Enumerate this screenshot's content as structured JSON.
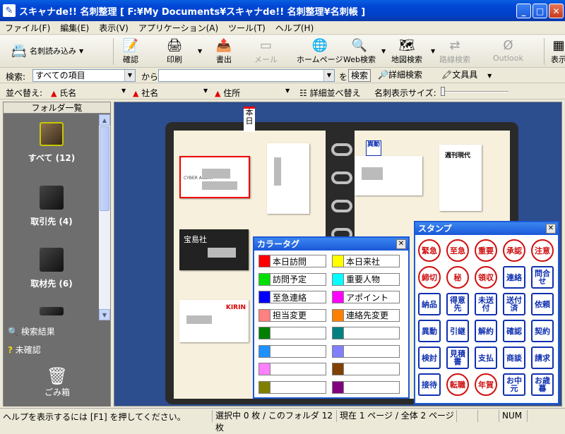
{
  "window": {
    "title": "スキャナde!! 名刺整理 [ F:¥My Documents¥スキャナde!! 名刺整理¥名刺帳 ]",
    "min": "_",
    "max": "□",
    "close": "✕"
  },
  "menu": [
    "ファイル(F)",
    "編集(E)",
    "表示(V)",
    "アプリケーション(A)",
    "ツール(T)",
    "ヘルプ(H)"
  ],
  "toolbar": {
    "scan": "名刺読み込み",
    "confirm": "確認",
    "print": "印刷",
    "export": "書出",
    "mail": "メール",
    "homepage": "ホームページ",
    "websearch": "Web検索",
    "mapsearch": "地図検索",
    "route": "路線検索",
    "outlook": "Outlook",
    "view": "表示"
  },
  "search": {
    "label": "検索:",
    "scope": "すべての項目",
    "from": "から",
    "wo": "を",
    "button": "検索",
    "detail": "詳細検索",
    "stationery": "文具具"
  },
  "sort": {
    "label": "並べ替え:",
    "k1": "氏名",
    "k2": "社名",
    "k3": "住所",
    "detail": "詳細並べ替え",
    "sizelabel": "名刺表示サイズ:"
  },
  "sidebar": {
    "header": "フォルダ一覧",
    "folders": [
      {
        "label": "すべて (12)"
      },
      {
        "label": "取引先 (4)"
      },
      {
        "label": "取材先 (6)"
      }
    ],
    "searchresult": "検索結果",
    "unconfirmed": "未確認",
    "trash": "ごみ箱"
  },
  "book": {
    "todaytab": "本日",
    "stamp_ikou": "異動",
    "company1": "宝島社",
    "company2": "KIRIN",
    "company3": "CYBER AGENT",
    "company4": "週刊現代"
  },
  "colortag": {
    "title": "カラータグ",
    "items": [
      {
        "label": "本日訪問",
        "color": "#ff0000"
      },
      {
        "label": "本日来社",
        "color": "#ffff00"
      },
      {
        "label": "訪問予定",
        "color": "#00e000"
      },
      {
        "label": "重要人物",
        "color": "#00ffff"
      },
      {
        "label": "至急連絡",
        "color": "#0000ff"
      },
      {
        "label": "アポイント",
        "color": "#ff00ff"
      },
      {
        "label": "担当変更",
        "color": "#ff8080"
      },
      {
        "label": "連絡先変更",
        "color": "#ff8000"
      },
      {
        "label": "",
        "color": "#008000"
      },
      {
        "label": "",
        "color": "#008080"
      },
      {
        "label": "",
        "color": "#1e90ff"
      },
      {
        "label": "",
        "color": "#8080ff"
      },
      {
        "label": "",
        "color": "#ff80ff"
      },
      {
        "label": "",
        "color": "#804000"
      },
      {
        "label": "",
        "color": "#808000"
      },
      {
        "label": "",
        "color": "#800080"
      }
    ]
  },
  "stamps": {
    "title": "スタンプ",
    "items": [
      {
        "t": "緊急",
        "c": "red"
      },
      {
        "t": "至急",
        "c": "red"
      },
      {
        "t": "重要",
        "c": "red"
      },
      {
        "t": "承認",
        "c": "red"
      },
      {
        "t": "注意",
        "c": "red"
      },
      {
        "t": "締切",
        "c": "red"
      },
      {
        "t": "秘",
        "c": "red"
      },
      {
        "t": "領収",
        "c": "red"
      },
      {
        "t": "連絡",
        "c": "blue"
      },
      {
        "t": "問合せ",
        "c": "blue"
      },
      {
        "t": "納品",
        "c": "blue"
      },
      {
        "t": "得意先",
        "c": "blue"
      },
      {
        "t": "未送付",
        "c": "blue"
      },
      {
        "t": "送付済",
        "c": "blue"
      },
      {
        "t": "依頼",
        "c": "blue"
      },
      {
        "t": "異動",
        "c": "blue"
      },
      {
        "t": "引継",
        "c": "blue"
      },
      {
        "t": "解約",
        "c": "blue"
      },
      {
        "t": "確認",
        "c": "blue"
      },
      {
        "t": "契約",
        "c": "blue"
      },
      {
        "t": "検討",
        "c": "blue"
      },
      {
        "t": "見積書",
        "c": "blue"
      },
      {
        "t": "支払",
        "c": "blue"
      },
      {
        "t": "商談",
        "c": "blue"
      },
      {
        "t": "請求",
        "c": "blue"
      },
      {
        "t": "接待",
        "c": "blue"
      },
      {
        "t": "転職",
        "c": "red"
      },
      {
        "t": "年賀",
        "c": "red"
      },
      {
        "t": "お中元",
        "c": "blue"
      },
      {
        "t": "お歳暮",
        "c": "blue"
      }
    ]
  },
  "status": {
    "help": "ヘルプを表示するには [F1] を押してください。",
    "selection": "選択中  0 枚 / このフォルダ 12 枚",
    "page": "現在 1 ページ / 全体 2 ページ",
    "num": "NUM"
  }
}
